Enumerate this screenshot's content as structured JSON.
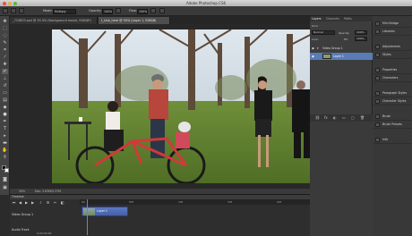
{
  "window": {
    "title": "Adobe Photoshop CS6"
  },
  "options_bar": {
    "mode_label": "Mode:",
    "mode_value": "Multiply",
    "opacity_label": "Opacity:",
    "opacity_value": "100%",
    "flow_label": "Flow:",
    "flow_value": "100%"
  },
  "tabs": [
    {
      "label": "_723853.psd @ 33.3% (Background movie, RGB/8*)",
      "active": false
    },
    {
      "label": "I_Line_here @ 50% (Layer 1, RGB/8)",
      "active": true
    }
  ],
  "status_bar": {
    "zoom": "50%",
    "doc_info": "Doc: 2.63M/5.37M"
  },
  "timeline": {
    "title": "Timeline",
    "ticks": [
      "00",
      "05f",
      "10f",
      "15f",
      "20f",
      "01:00f"
    ],
    "track_label": "Video Group 1",
    "clip_label": "Layer 1",
    "audio_label": "Audio Track",
    "time_readout": "0;00;00;00"
  },
  "layers_panel": {
    "tabs": [
      "Layers",
      "Channels",
      "Paths"
    ],
    "kind_label": "Kind",
    "blend_mode": "Normal",
    "opacity_label": "Opacity:",
    "opacity_value": "100%",
    "lock_label": "Lock:",
    "fill_label": "Fill:",
    "fill_value": "100%",
    "group_label": "Video Group 1",
    "layer_label": "Layer 1"
  },
  "dock": [
    {
      "label": "Mini Bridge",
      "icon": "bridge-icon"
    },
    {
      "label": "Libraries",
      "icon": "library-icon"
    },
    {
      "label": "Adjustments",
      "icon": "adjustments-icon"
    },
    {
      "label": "Styles",
      "icon": "styles-icon"
    },
    {
      "label": "Properties",
      "icon": "properties-icon"
    },
    {
      "label": "Characters",
      "icon": "character-icon"
    },
    {
      "label": "Paragraph Styles",
      "icon": "paragraph-styles-icon"
    },
    {
      "label": "Character Styles",
      "icon": "character-styles-icon"
    },
    {
      "label": "Brush",
      "icon": "brush-icon"
    },
    {
      "label": "Brush Presets",
      "icon": "brush-presets-icon"
    },
    {
      "label": "Info",
      "icon": "info-icon"
    }
  ],
  "colors": {
    "selection": "#5a7bb5",
    "clip": "#5b78c4",
    "playhead": "#5a8ad6"
  }
}
